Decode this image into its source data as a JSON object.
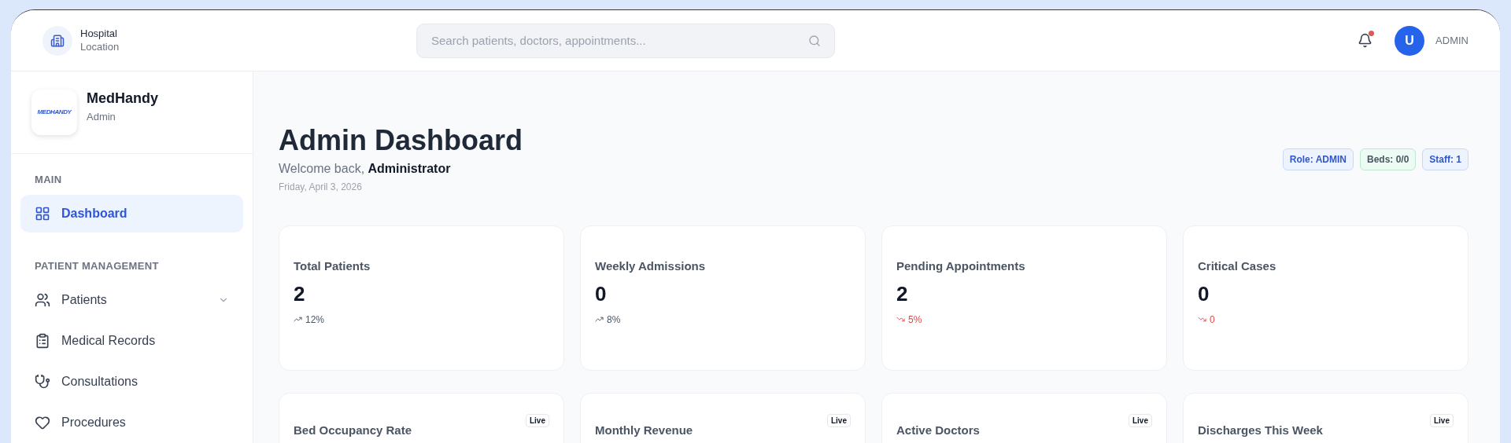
{
  "topbar": {
    "location_title": "Hospital",
    "location_subtitle": "Location",
    "search": {
      "placeholder": "Search patients, doctors, appointments..."
    },
    "notifications": {
      "unread": true
    },
    "user": {
      "initial": "U",
      "name": "ADMIN"
    }
  },
  "sidebar": {
    "brand": {
      "logo_text": "MEDHANDY",
      "name": "MedHandy",
      "role": "Admin"
    },
    "sections": [
      {
        "title": "MAIN",
        "items": [
          {
            "label": "Dashboard",
            "selected": true,
            "has_submenu": false
          }
        ]
      },
      {
        "title": "PATIENT MANAGEMENT",
        "items": [
          {
            "label": "Patients",
            "selected": false,
            "has_submenu": true
          },
          {
            "label": "Medical Records",
            "selected": false,
            "has_submenu": false
          },
          {
            "label": "Consultations",
            "selected": false,
            "has_submenu": false
          },
          {
            "label": "Procedures",
            "selected": false,
            "has_submenu": false
          }
        ]
      }
    ]
  },
  "header": {
    "title": "Admin Dashboard",
    "welcome": "Welcome back, **Administrator**",
    "date": "Friday, April 3, 2026",
    "badges": [
      {
        "text": "Role: ADMIN",
        "kind": "info"
      },
      {
        "text": "Beds: 0/0",
        "kind": "success"
      },
      {
        "text": "Staff: 1",
        "kind": "info"
      }
    ]
  },
  "stats": [
    {
      "label": "Total Patients",
      "value": "2",
      "trend": {
        "rising": true,
        "text": "12%"
      }
    },
    {
      "label": "Weekly Admissions",
      "value": "0",
      "trend": {
        "rising": true,
        "text": "8%"
      }
    },
    {
      "label": "Pending Appointments",
      "value": "2",
      "trend": {
        "rising": false,
        "text": "5%"
      }
    },
    {
      "label": "Critical Cases",
      "value": "0",
      "trend": {
        "rising": false,
        "text": "0"
      }
    }
  ],
  "live_cards": [
    {
      "label": "Bed Occupancy Rate",
      "badge": "Live"
    },
    {
      "label": "Monthly Revenue",
      "badge": "Live"
    },
    {
      "label": "Active Doctors",
      "badge": "Live"
    },
    {
      "label": "Discharges This Week",
      "badge": "Live"
    }
  ]
}
